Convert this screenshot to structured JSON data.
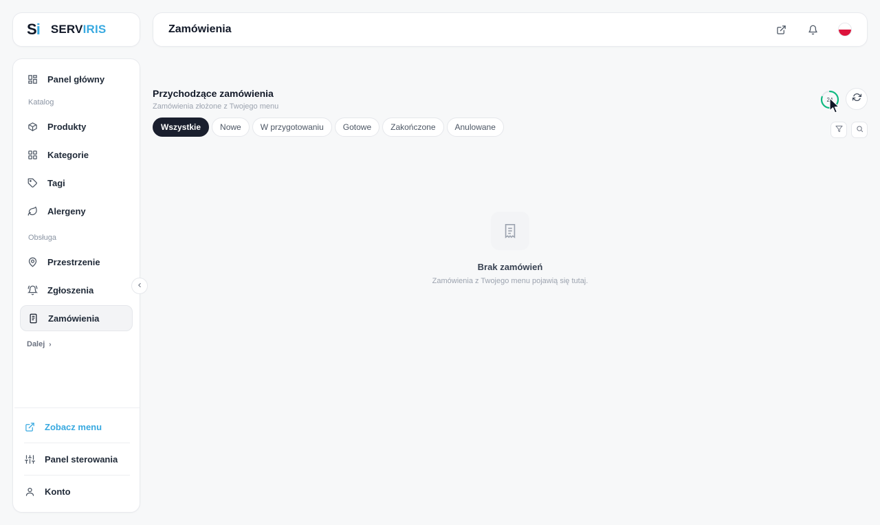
{
  "brand": {
    "mark_s": "S",
    "mark_i": "i",
    "name_main": "SERV",
    "name_accent": "IRIS",
    "accent_color": "#38a9e0"
  },
  "header": {
    "title": "Zamówienia",
    "icons": [
      "external-link-icon",
      "bell-icon",
      "polish-flag-icon"
    ]
  },
  "sidebar": {
    "items_top": [
      {
        "label": "Panel główny",
        "icon": "grid-dashboard-icon"
      }
    ],
    "section_catalog": "Katalog",
    "items_catalog": [
      {
        "label": "Produkty",
        "icon": "box-icon"
      },
      {
        "label": "Kategorie",
        "icon": "grid-icon"
      },
      {
        "label": "Tagi",
        "icon": "tag-icon"
      },
      {
        "label": "Alergeny",
        "icon": "leaf-icon"
      }
    ],
    "section_service": "Obsługa",
    "items_service": [
      {
        "label": "Przestrzenie",
        "icon": "map-pin-icon"
      },
      {
        "label": "Zgłoszenia",
        "icon": "bell-ring-icon"
      },
      {
        "label": "Zamówienia",
        "icon": "receipt-icon",
        "active": true
      }
    ],
    "more_label": "Dalej",
    "bottom": [
      {
        "label": "Zobacz menu",
        "icon": "external-link-icon"
      },
      {
        "label": "Panel sterowania",
        "icon": "sliders-icon"
      },
      {
        "label": "Konto",
        "icon": "user-icon"
      }
    ]
  },
  "main": {
    "title": "Przychodzące zamówienia",
    "subtitle": "Zamówienia złożone z Twojego menu",
    "tabs": [
      {
        "label": "Wszystkie",
        "active": true
      },
      {
        "label": "Nowe"
      },
      {
        "label": "W przygotowaniu"
      },
      {
        "label": "Gotowe"
      },
      {
        "label": "Zakończone"
      },
      {
        "label": "Anulowane"
      }
    ],
    "timer_value": "24",
    "timer_progress": 0.8,
    "timer_color": "#10b981"
  },
  "empty_state": {
    "title": "Brak zamówień",
    "subtitle": "Zamówienia z Twojego menu pojawią się tutaj."
  }
}
